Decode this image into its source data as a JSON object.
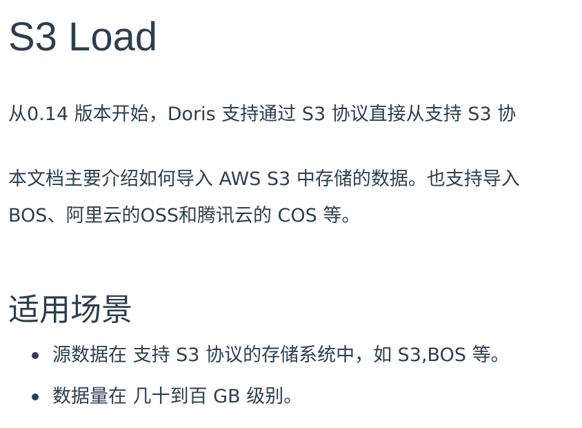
{
  "title": "S3 Load",
  "intro": {
    "line1": "从0.14 版本开始，Doris 支持通过 S3 协议直接从支持 S3 协",
    "line2": "本文档主要介绍如何导入 AWS S3 中存储的数据。也支持导入",
    "line3": "BOS、阿里云的OSS和腾讯云的 COS 等。"
  },
  "section": {
    "heading": "适用场景",
    "items": [
      {
        "text": "源数据在 支持 S3 协议的存储系统中，如 S3,BOS 等。"
      },
      {
        "text": "数据量在 几十到百 GB 级别。"
      }
    ]
  }
}
